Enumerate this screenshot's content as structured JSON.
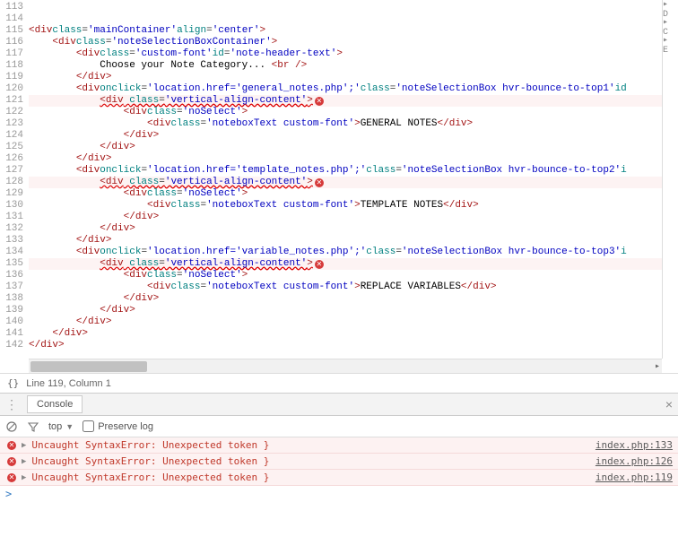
{
  "editor": {
    "first_line_number": 113,
    "lines": [
      {
        "indent": 0,
        "type": "open",
        "tag": "div",
        "attrs": [
          [
            "class",
            "mainContainer"
          ],
          [
            "align",
            "center"
          ]
        ]
      },
      {
        "indent": 1,
        "type": "open",
        "tag": "div",
        "attrs": [
          [
            "class",
            "noteSelectionBoxContainer"
          ]
        ]
      },
      {
        "indent": 2,
        "type": "open",
        "tag": "div",
        "attrs": [
          [
            "class",
            "custom-font"
          ],
          [
            "id",
            "note-header-text"
          ]
        ]
      },
      {
        "indent": 3,
        "type": "text",
        "content": "Choose your Note Category... ",
        "selfclose": "br"
      },
      {
        "indent": 2,
        "type": "close",
        "tag": "div"
      },
      {
        "indent": 2,
        "type": "open",
        "tag": "div",
        "attrs": [
          [
            "onclick",
            "location.href='general_notes.php';"
          ],
          [
            "class",
            "noteSelectionBox hvr-bounce-to-top1"
          ]
        ],
        "truncated": "id"
      },
      {
        "indent": 3,
        "type": "open",
        "tag": "div",
        "attrs": [
          [
            "class",
            "vertical-align-content"
          ]
        ],
        "error": true,
        "hl": true
      },
      {
        "indent": 4,
        "type": "open",
        "tag": "div",
        "attrs": [
          [
            "class",
            "noSelect"
          ]
        ]
      },
      {
        "indent": 5,
        "type": "inline",
        "tag": "div",
        "attrs": [
          [
            "class",
            "noteboxText custom-font"
          ]
        ],
        "text": "GENERAL NOTES"
      },
      {
        "indent": 4,
        "type": "close",
        "tag": "div"
      },
      {
        "indent": 3,
        "type": "close",
        "tag": "div"
      },
      {
        "indent": 2,
        "type": "close",
        "tag": "div"
      },
      {
        "indent": 2,
        "type": "open",
        "tag": "div",
        "attrs": [
          [
            "onclick",
            "location.href='template_notes.php';"
          ],
          [
            "class",
            "noteSelectionBox hvr-bounce-to-top2"
          ]
        ],
        "truncated": "i"
      },
      {
        "indent": 3,
        "type": "open",
        "tag": "div",
        "attrs": [
          [
            "class",
            "vertical-align-content"
          ]
        ],
        "error": true,
        "hl": true
      },
      {
        "indent": 4,
        "type": "open",
        "tag": "div",
        "attrs": [
          [
            "class",
            "noSelect"
          ]
        ]
      },
      {
        "indent": 5,
        "type": "inline",
        "tag": "div",
        "attrs": [
          [
            "class",
            "noteboxText custom-font"
          ]
        ],
        "text": "TEMPLATE NOTES"
      },
      {
        "indent": 4,
        "type": "close",
        "tag": "div"
      },
      {
        "indent": 3,
        "type": "close",
        "tag": "div"
      },
      {
        "indent": 2,
        "type": "close",
        "tag": "div"
      },
      {
        "indent": 2,
        "type": "open",
        "tag": "div",
        "attrs": [
          [
            "onclick",
            "location.href='variable_notes.php';"
          ],
          [
            "class",
            "noteSelectionBox hvr-bounce-to-top3"
          ]
        ],
        "truncated": "i"
      },
      {
        "indent": 3,
        "type": "open",
        "tag": "div",
        "attrs": [
          [
            "class",
            "vertical-align-content"
          ]
        ],
        "error": true,
        "hl": true
      },
      {
        "indent": 4,
        "type": "open",
        "tag": "div",
        "attrs": [
          [
            "class",
            "noSelect"
          ]
        ]
      },
      {
        "indent": 5,
        "type": "inline",
        "tag": "div",
        "attrs": [
          [
            "class",
            "noteboxText custom-font"
          ]
        ],
        "text": "REPLACE VARIABLES"
      },
      {
        "indent": 4,
        "type": "close",
        "tag": "div"
      },
      {
        "indent": 3,
        "type": "close",
        "tag": "div"
      },
      {
        "indent": 2,
        "type": "close",
        "tag": "div"
      },
      {
        "indent": 1,
        "type": "close",
        "tag": "div"
      },
      {
        "indent": 0,
        "type": "close",
        "tag": "div"
      },
      {
        "indent": 0,
        "type": "blank"
      },
      {
        "indent": 0,
        "type": "blank"
      }
    ]
  },
  "status": {
    "position": "Line 119, Column 1"
  },
  "console": {
    "tab_label": "Console",
    "filter_context": "top",
    "preserve_log_label": "Preserve log",
    "errors": [
      {
        "message": "Uncaught SyntaxError: Unexpected token }",
        "source": "index.php:133"
      },
      {
        "message": "Uncaught SyntaxError: Unexpected token }",
        "source": "index.php:126"
      },
      {
        "message": "Uncaught SyntaxError: Unexpected token }",
        "source": "index.php:119"
      }
    ],
    "prompt": ">"
  },
  "sidebar_hints": [
    "▸ D",
    "▸ C",
    "▸ E"
  ]
}
